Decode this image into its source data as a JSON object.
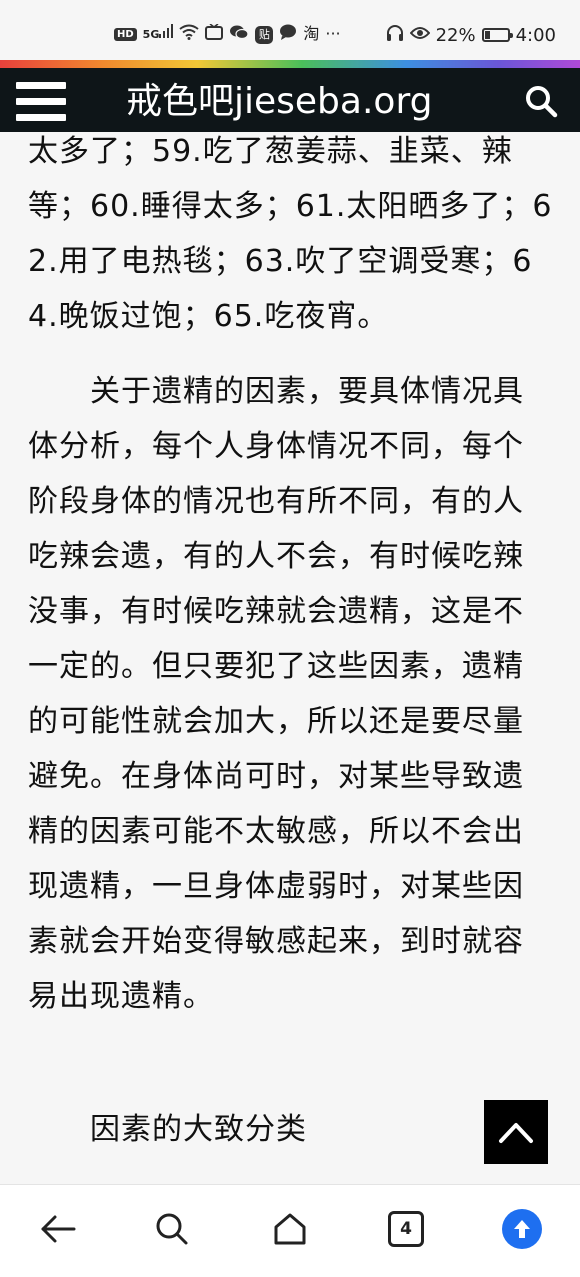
{
  "status_bar": {
    "hd_badge": "HD",
    "network": "5G",
    "battery_percent": "22%",
    "battery_level": 0.22,
    "time": "4:00",
    "overflow": "···",
    "taobao": "淘",
    "tie": "贴"
  },
  "header": {
    "title": "戒色吧jieseba.org"
  },
  "article": {
    "p1": "太多了；59.吃了葱姜蒜、韭菜、辣等；60.睡得太多；61.太阳晒多了；62.用了电热毯；63.吹了空调受寒；64.晚饭过饱；65.吃夜宵。",
    "p2": "关于遗精的因素，要具体情况具体分析，每个人身体情况不同，每个阶段身体的情况也有所不同，有的人吃辣会遗，有的人不会，有时候吃辣没事，有时候吃辣就会遗精，这是不一定的。但只要犯了这些因素，遗精的可能性就会加大，所以还是要尽量避免。在身体尚可时，对某些导致遗精的因素可能不太敏感，所以不会出现遗精，一旦身体虚弱时，对某些因素就会开始变得敏感起来，到时就容易出现遗精。",
    "p3": "因素的大致分类"
  },
  "bottom_nav": {
    "tab_count": "4"
  },
  "colors": {
    "header_bg": "#0e1518",
    "accent": "#1e6ff0"
  }
}
